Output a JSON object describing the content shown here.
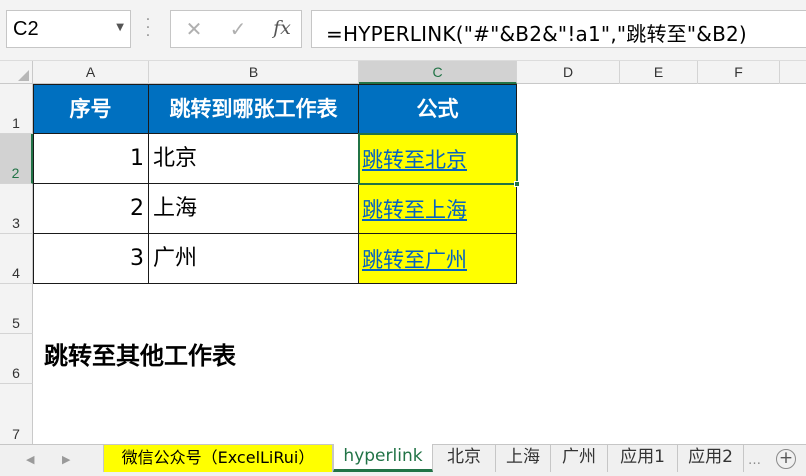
{
  "formula_bar": {
    "name_box": "C2",
    "cancel_glyph": "✕",
    "enter_glyph": "✓",
    "fx_glyph": "fx",
    "formula": "=HYPERLINK(\"#\"&B2&\"!a1\",\"跳转至\"&B2)"
  },
  "columns": [
    "A",
    "B",
    "C",
    "D",
    "E",
    "F"
  ],
  "rows": [
    "1",
    "2",
    "3",
    "4",
    "5",
    "6",
    "7"
  ],
  "selected": {
    "column": "C",
    "row": "2"
  },
  "table": {
    "headers": [
      "序号",
      "跳转到哪张工作表",
      "公式"
    ],
    "data": [
      {
        "index": "1",
        "sheet": "北京",
        "link": "跳转至北京"
      },
      {
        "index": "2",
        "sheet": "上海",
        "link": "跳转至上海"
      },
      {
        "index": "3",
        "sheet": "广州",
        "link": "跳转至广州"
      }
    ]
  },
  "note": "跳转至其他工作表",
  "sheet_tabs": {
    "promo": "微信公众号（ExcelLiRui）",
    "active": "hyperlink",
    "others": [
      "北京",
      "上海",
      "广州",
      "应用1",
      "应用2"
    ]
  },
  "icons": {
    "nav_prev": "chevron-left-icon",
    "nav_next": "chevron-right-icon",
    "more": "more-icon",
    "add_sheet": "plus-circle-icon"
  },
  "colors": {
    "header_fill": "#0070c0",
    "link_fill": "#ffff00",
    "link_text": "#0563c1",
    "excel_green": "#217346"
  }
}
